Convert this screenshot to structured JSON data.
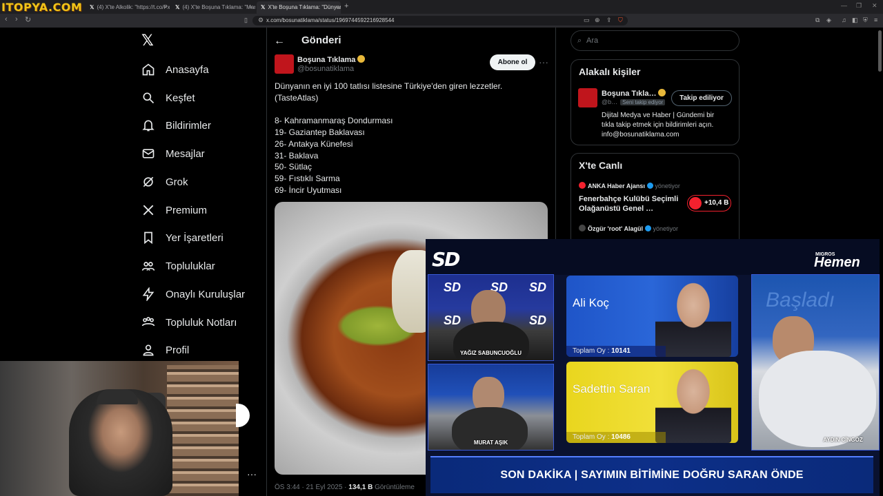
{
  "browser": {
    "site_logo": "ITOPYA.COM",
    "tabs": [
      {
        "label": "(4) X'te Alkolik: \"https://t.co/PxXsxh…",
        "active": false
      },
      {
        "label": "(4) X'te Boşuna Tıklama: \"Marmaray'…",
        "active": false
      },
      {
        "label": "X'te Boşuna Tıklama: \"Dünyanın…",
        "active": true
      }
    ],
    "url": "x.com/bosunatiklama/status/1969744592216928544"
  },
  "x_app": {
    "nav": [
      {
        "label": "Anasayfa",
        "icon": "home-icon"
      },
      {
        "label": "Keşfet",
        "icon": "search-icon"
      },
      {
        "label": "Bildirimler",
        "icon": "bell-icon"
      },
      {
        "label": "Mesajlar",
        "icon": "mail-icon"
      },
      {
        "label": "Grok",
        "icon": "grok-icon"
      },
      {
        "label": "Premium",
        "icon": "x-icon"
      },
      {
        "label": "Yer İşaretleri",
        "icon": "bookmark-icon"
      },
      {
        "label": "Topluluklar",
        "icon": "communities-icon"
      },
      {
        "label": "Onaylı Kuruluşlar",
        "icon": "lightning-icon"
      },
      {
        "label": "Topluluk Notları",
        "icon": "notes-icon"
      },
      {
        "label": "Profil",
        "icon": "user-icon"
      }
    ],
    "header_title": "Gönderi",
    "post": {
      "author": "Boşuna Tıklama",
      "handle": "@bosunatiklama",
      "subscribe": "Abone ol",
      "lines": [
        "Dünyanın en iyi 100 tatlısı listesine Türkiye'den giren lezzetler.",
        "(TasteAtlas)",
        "",
        "8- Kahramanmaraş Dondurması",
        "19- Gaziantep Baklavası",
        "26- Antakya Künefesi",
        "31- Baklava",
        "50- Sütlaç",
        "59- Fıstıklı Sarma",
        "69- İncir Uyutması"
      ],
      "time": "ÖS 3:44 · 21 Eyl 2025 · ",
      "views": "134,1 B",
      "views_label": " Görüntüleme"
    },
    "search_placeholder": "Ara",
    "related": {
      "title": "Alakalı kişiler",
      "name": "Boşuna Tıkla…",
      "handle": "@b…",
      "follows_you": "Seni takip ediyor",
      "following_btn": "Takip ediliyor",
      "bio": [
        "Dijital Medya ve Haber | Gündemi bir",
        "tıkla takip etmek için bildirimleri açın.",
        "info@bosunatiklama.com"
      ]
    },
    "live": {
      "title": "X'te Canlı",
      "item1_account": "ANKA Haber Ajansı",
      "item1_role": "yönetiyor",
      "item1_title": [
        "Fenerbahçe Kulübü Seçimli",
        "Olağanüstü Genel …"
      ],
      "item1_count": "+10,4 B",
      "item2_account": "Özgür 'root' Alagül",
      "item2_role": "yönetiyor"
    }
  },
  "tv": {
    "channel": "SD",
    "sponsor_top": "MIGROS",
    "sponsor": "Hemen",
    "studio_names": [
      "YAĞIZ SABUNCUOĞLU",
      "MURAT AŞIK",
      "AYDIN CİNGÖZ"
    ],
    "candidates": [
      {
        "name": "Ali Koç",
        "votes_label": "Toplam Oy : ",
        "votes": "10141"
      },
      {
        "name": "Sadettin Saran",
        "votes_label": "Toplam Oy : ",
        "votes": "10486"
      }
    ],
    "ticker": "SON DAKİKA | SAYIMIN BİTİMİNE DOĞRU SARAN ÖNDE"
  },
  "colors": {
    "accent": "#1d9bf0",
    "brand_red": "#c0151c",
    "live_red": "#f4212e",
    "tv_blue": "#0a2a7a",
    "candidate2_yellow": "#e9d61e"
  }
}
